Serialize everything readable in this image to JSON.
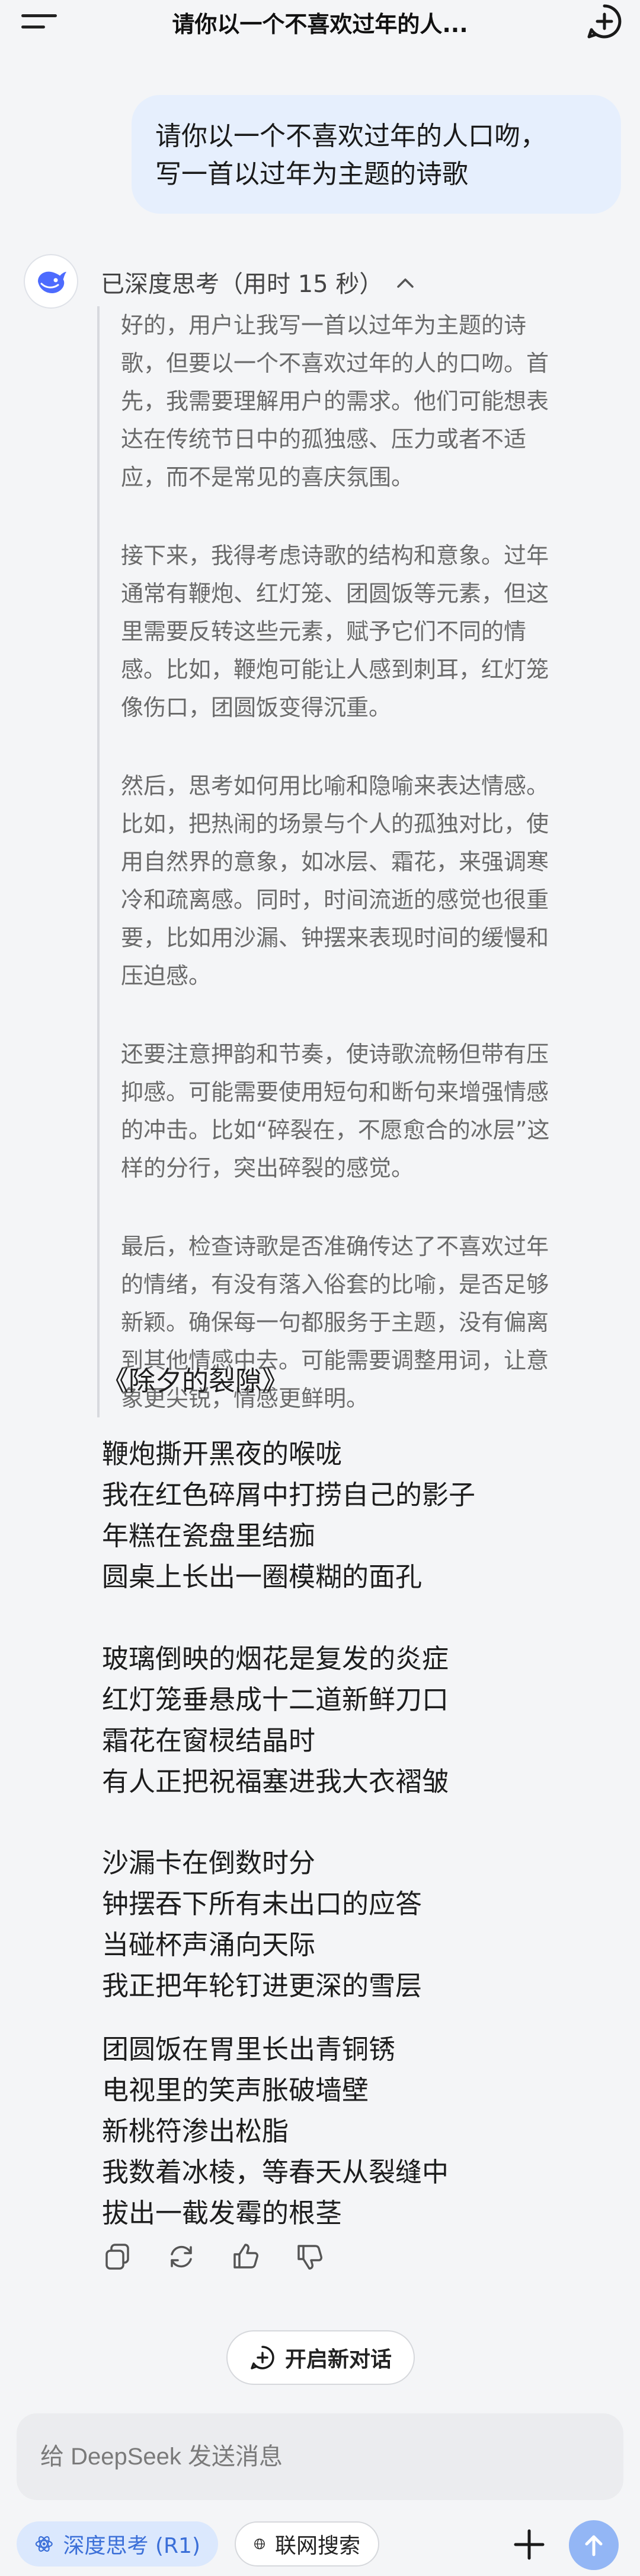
{
  "header": {
    "title": "请你以一个不喜欢过年的人..."
  },
  "user_message": {
    "lines": [
      "请你以一个不喜欢过年的人口吻，",
      "写一首以过年为主题的诗歌"
    ]
  },
  "deep_think": {
    "label": "已深度思考（用时 15 秒）",
    "paragraphs": [
      [
        "好的，用户让我写一首以过年为主题的诗",
        "歌，但要以一个不喜欢过年的人的口吻。首",
        "先，我需要理解用户的需求。他们可能想表",
        "达在传统节日中的孤独感、压力或者不适",
        "应，而不是常见的喜庆氛围。"
      ],
      [
        "接下来，我得考虑诗歌的结构和意象。过年",
        "通常有鞭炮、红灯笼、团圆饭等元素，但这",
        "里需要反转这些元素，赋予它们不同的情",
        "感。比如，鞭炮可能让人感到刺耳，红灯笼",
        "像伤口，团圆饭变得沉重。"
      ],
      [
        "然后，思考如何用比喻和隐喻来表达情感。",
        "比如，把热闹的场景与个人的孤独对比，使",
        "用自然界的意象，如冰层、霜花，来强调寒",
        "冷和疏离感。同时，时间流逝的感觉也很重",
        "要，比如用沙漏、钟摆来表现时间的缓慢和",
        "压迫感。"
      ],
      [
        "还要注意押韵和节奏，使诗歌流畅但带有压",
        "抑感。可能需要使用短句和断句来增强情感",
        "的冲击。比如“碎裂在，不愿愈合的冰层”这",
        "样的分行，突出碎裂的感觉。"
      ],
      [
        "最后，检查诗歌是否准确传达了不喜欢过年",
        "的情绪，有没有落入俗套的比喻，是否足够",
        "新颖。确保每一句都服务于主题，没有偏离",
        "到其他情感中去。可能需要调整用词，让意",
        "象更尖锐，情感更鲜明。"
      ]
    ]
  },
  "poem": {
    "title": "《除夕的裂隙》",
    "stanzas": [
      [
        "鞭炮撕开黑夜的喉咙",
        "我在红色碎屑中打捞自己的影子",
        "年糕在瓷盘里结痂",
        "圆桌上长出一圈模糊的面孔"
      ],
      [
        "玻璃倒映的烟花是复发的炎症",
        "红灯笼垂悬成十二道新鲜刀口",
        "霜花在窗棂结晶时",
        "有人正把祝福塞进我大衣褶皱"
      ],
      [
        "沙漏卡在倒数时分",
        "钟摆吞下所有未出口的应答",
        "当碰杯声涌向天际",
        "我正把年轮钉进更深的雪层"
      ],
      [
        "团圆饭在胃里长出青铜锈",
        "电视里的笑声胀破墙壁",
        "新桃符渗出松脂",
        "我数着冰棱，等春天从裂缝中",
        "拔出一截发霉的根茎"
      ]
    ]
  },
  "actions": {
    "icons": [
      "copy-icon",
      "regenerate-icon",
      "thumbs-up-icon",
      "thumbs-down-icon"
    ]
  },
  "new_chat": {
    "label": "开启新对话"
  },
  "composer": {
    "placeholder": "给 DeepSeek 发送消息",
    "deep_think_label": "深度思考 (R1)",
    "web_search_label": "联网搜索"
  },
  "colors": {
    "accent": "#3b6fd8",
    "user_bubble": "#e6effd",
    "send_button": "#93b6f5"
  }
}
